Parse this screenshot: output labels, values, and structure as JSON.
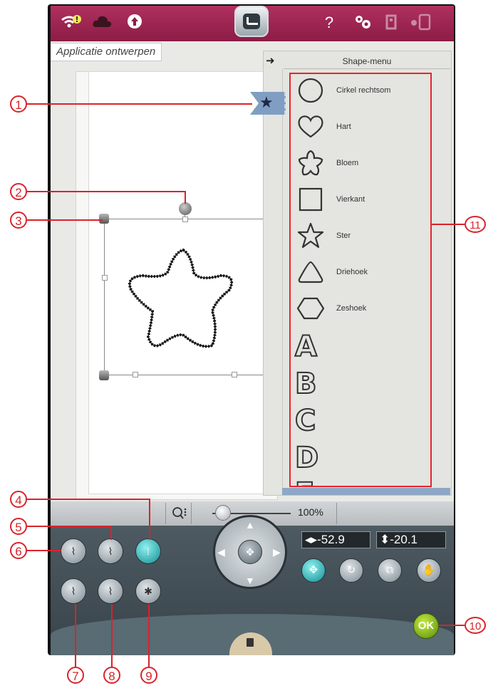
{
  "topbar": {
    "wifi_icon": "wifi-warning-icon",
    "cloud_icon": "cloud-icon",
    "upload_icon": "upload-icon",
    "help_label": "?",
    "settings_icon": "gears-icon"
  },
  "tab": {
    "title": "Applicatie ontwerpen"
  },
  "shape_menu": {
    "title": "Shape-menu",
    "items": [
      {
        "label": "Cirkel rechtsom",
        "icon": "circle"
      },
      {
        "label": "Hart",
        "icon": "heart"
      },
      {
        "label": "Bloem",
        "icon": "flower"
      },
      {
        "label": "Vierkant",
        "icon": "square"
      },
      {
        "label": "Ster",
        "icon": "star"
      },
      {
        "label": "Driehoek",
        "icon": "triangle"
      },
      {
        "label": "Zeshoek",
        "icon": "hexagon"
      }
    ],
    "letters": [
      "A",
      "B",
      "C",
      "D",
      "E"
    ]
  },
  "zoom": {
    "value": "100%"
  },
  "position": {
    "x": "◂▸-52.9",
    "y": "⬍-20.1"
  },
  "buttons": {
    "ok": "OK"
  },
  "callouts": [
    "1",
    "2",
    "3",
    "4",
    "5",
    "6",
    "7",
    "8",
    "9",
    "10",
    "11"
  ],
  "colors": {
    "accent": "#9d2452",
    "callout": "#d9232b",
    "active": "#1aa3a8",
    "ok": "#7db51d"
  }
}
